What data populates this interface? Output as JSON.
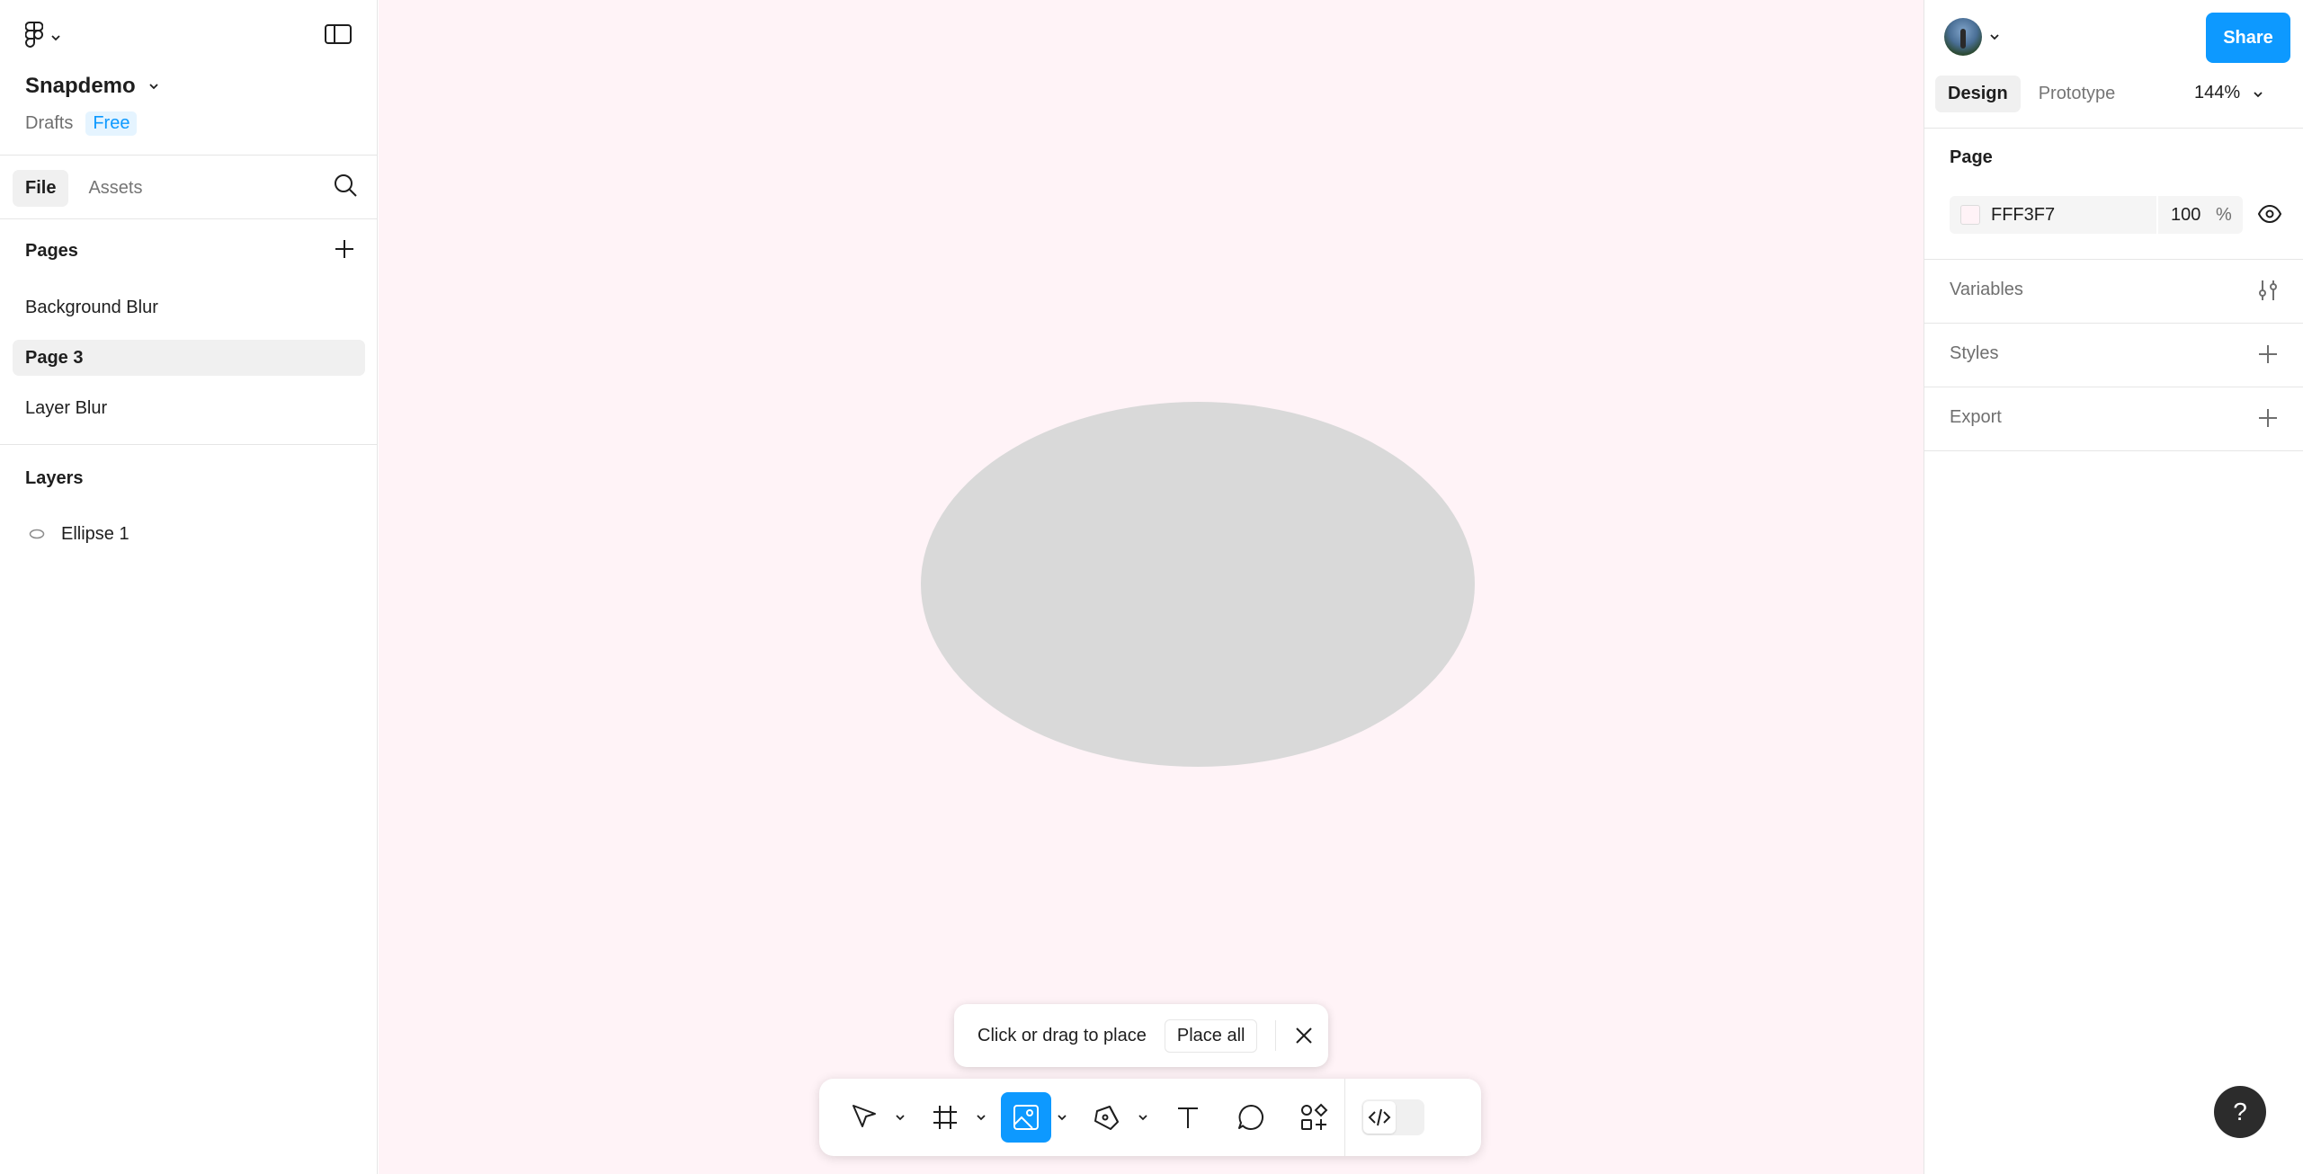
{
  "file": {
    "name": "Snapdemo",
    "location": "Drafts",
    "plan": "Free"
  },
  "left_tabs": [
    "File",
    "Assets"
  ],
  "pages": {
    "heading": "Pages",
    "items": [
      "Background Blur",
      "Page 3",
      "Layer Blur"
    ],
    "active": "Page 3"
  },
  "layers": {
    "heading": "Layers",
    "items": [
      {
        "name": "Ellipse 1",
        "icon": "ellipse-icon"
      }
    ]
  },
  "canvas": {
    "background": "#fff3f7",
    "ellipse_fill": "#d9d9d9"
  },
  "place_toast": {
    "message": "Click or drag to place",
    "place_all": "Place all"
  },
  "toolbar": {
    "tools": [
      "move-tool",
      "frame-tool",
      "image-tool",
      "pen-tool",
      "text-tool",
      "comment-tool",
      "actions-tool",
      "dev-mode-toggle"
    ],
    "active": "image-tool",
    "accent": "#0d99ff"
  },
  "right": {
    "share": "Share",
    "tabs": [
      "Design",
      "Prototype"
    ],
    "zoom": "144%",
    "page_section": "Page",
    "page_color": "FFF3F7",
    "page_opacity": "100",
    "percent": "%",
    "variables": "Variables",
    "styles": "Styles",
    "export": "Export"
  },
  "help": "?"
}
